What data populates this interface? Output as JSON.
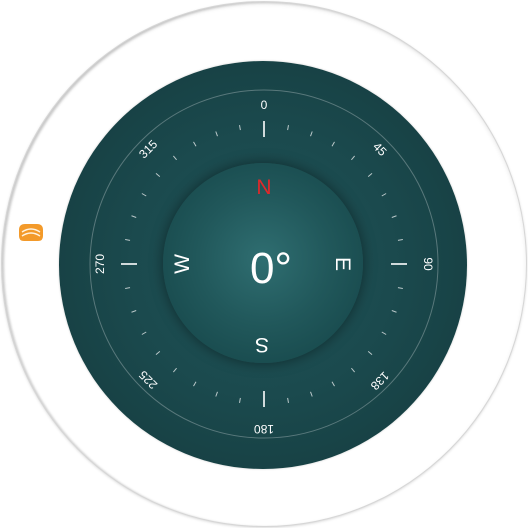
{
  "compass": {
    "heading": "0°",
    "cardinals": {
      "north": "N",
      "east": "E",
      "south": "S",
      "west": "W"
    },
    "degree_labels": {
      "d0": "0",
      "d45": "45",
      "d90": "90",
      "d138": "138",
      "d180": "180",
      "d225": "225",
      "d270": "270",
      "d315": "315"
    }
  },
  "colors": {
    "dial": "#1b4a4e",
    "north": "#e0282a",
    "text": "#ffffff",
    "tab": "#f39a2a"
  },
  "side_tab": {
    "icon": "drawer-handle-icon"
  }
}
